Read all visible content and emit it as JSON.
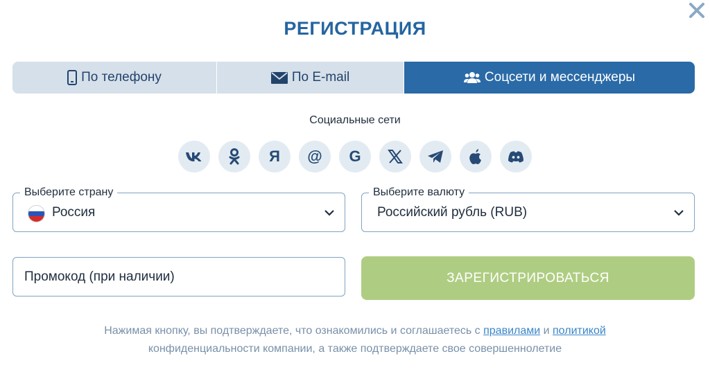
{
  "title": "РЕГИСТРАЦИЯ",
  "tabs": [
    {
      "label": "По телефону",
      "icon": "phone-icon"
    },
    {
      "label": "По E-mail",
      "icon": "envelope-icon"
    },
    {
      "label": "Соцсети и мессенджеры",
      "icon": "users-icon",
      "active": true
    }
  ],
  "social": {
    "label": "Социальные сети",
    "networks": [
      {
        "name": "vk",
        "glyph": "vk"
      },
      {
        "name": "odnoklassniki",
        "glyph": ""
      },
      {
        "name": "yandex",
        "glyph": "Я"
      },
      {
        "name": "mail-ru",
        "glyph": "@"
      },
      {
        "name": "google",
        "glyph": "G"
      },
      {
        "name": "x",
        "glyph": "𝕏"
      },
      {
        "name": "telegram",
        "glyph": ""
      },
      {
        "name": "apple",
        "glyph": ""
      },
      {
        "name": "discord",
        "glyph": ""
      }
    ]
  },
  "country": {
    "legend": "Выберите страну",
    "value": "Россия"
  },
  "currency": {
    "legend": "Выберите валюту",
    "value": "Российский рубль (RUB)"
  },
  "promo": {
    "placeholder": "Промокод (при наличии)"
  },
  "register": {
    "label": "ЗАРЕГИСТРИРОВАТЬСЯ"
  },
  "disclaimer": {
    "prefix": "Нажимая кнопку, вы подтверждаете, что ознакомились и соглашаетесь с ",
    "rules_link": "правилами",
    "and": " и ",
    "policy_link": "политикой",
    "suffix": "конфиденциальности компании, а также подтверждаете свое совершеннолетие"
  },
  "colors": {
    "accent": "#2565a0",
    "active_tab": "#2a6aa7",
    "tab_bg": "#d6e0ea",
    "register_btn": "#afcd82",
    "link": "#3a86c8"
  }
}
